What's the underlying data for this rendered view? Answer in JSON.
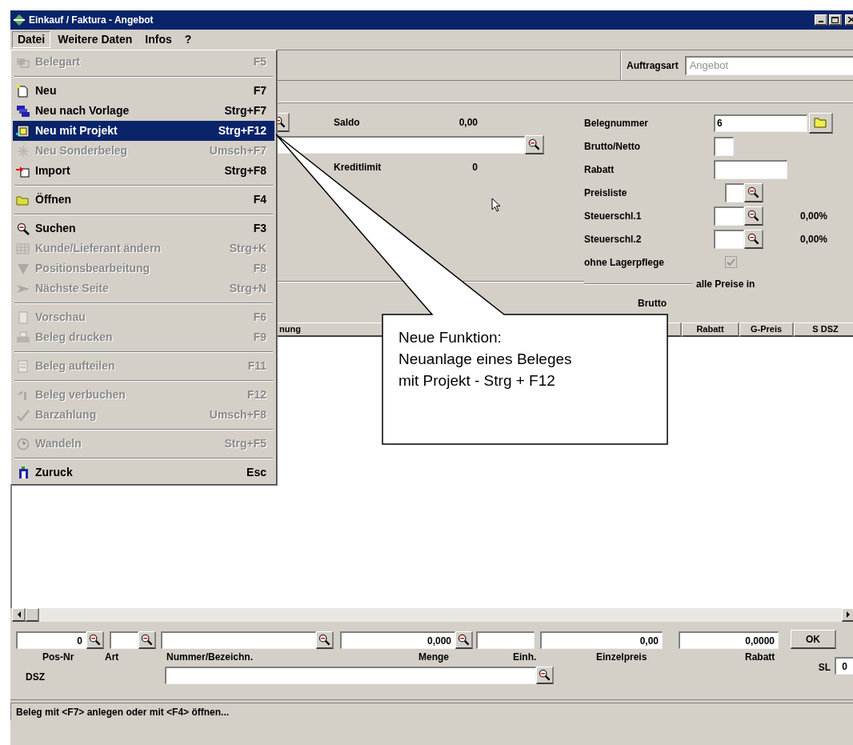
{
  "window": {
    "title": "Einkauf / Faktura - Angebot"
  },
  "menubar": [
    {
      "label": "Datei",
      "selected": true
    },
    {
      "label": "Weitere Daten",
      "selected": false
    },
    {
      "label": "Infos",
      "selected": false
    },
    {
      "label": "?",
      "selected": false
    }
  ],
  "menu": [
    {
      "kind": "item",
      "label": "Belegart",
      "shortcut": "F5",
      "disabled": true,
      "selected": false
    },
    {
      "kind": "separator"
    },
    {
      "kind": "item",
      "label": "Neu",
      "shortcut": "F7",
      "disabled": false,
      "selected": false
    },
    {
      "kind": "item",
      "label": "Neu nach Vorlage",
      "shortcut": "Strg+F7",
      "disabled": false,
      "selected": false
    },
    {
      "kind": "item",
      "label": "Neu mit Projekt",
      "shortcut": "Strg+F12",
      "disabled": false,
      "selected": true
    },
    {
      "kind": "item",
      "label": "Neu Sonderbeleg",
      "shortcut": "Umsch+F7",
      "disabled": true,
      "selected": false
    },
    {
      "kind": "item",
      "label": "Import",
      "shortcut": "Strg+F8",
      "disabled": false,
      "selected": false
    },
    {
      "kind": "separator"
    },
    {
      "kind": "item",
      "label": "Öffnen",
      "shortcut": "F4",
      "disabled": false,
      "selected": false
    },
    {
      "kind": "separator"
    },
    {
      "kind": "item",
      "label": "Suchen",
      "shortcut": "F3",
      "disabled": false,
      "selected": false
    },
    {
      "kind": "item",
      "label": "Kunde/Lieferant ändern",
      "shortcut": "Strg+K",
      "disabled": true,
      "selected": false
    },
    {
      "kind": "item",
      "label": "Positionsbearbeitung",
      "shortcut": "F8",
      "disabled": true,
      "selected": false
    },
    {
      "kind": "item",
      "label": "Nächste Seite",
      "shortcut": "Strg+N",
      "disabled": true,
      "selected": false
    },
    {
      "kind": "separator"
    },
    {
      "kind": "item",
      "label": "Vorschau",
      "shortcut": "F6",
      "disabled": true,
      "selected": false
    },
    {
      "kind": "item",
      "label": "Beleg drucken",
      "shortcut": "F9",
      "disabled": true,
      "selected": false
    },
    {
      "kind": "separator"
    },
    {
      "kind": "item",
      "label": "Beleg aufteilen",
      "shortcut": "F11",
      "disabled": true,
      "selected": false
    },
    {
      "kind": "separator"
    },
    {
      "kind": "item",
      "label": "Beleg verbuchen",
      "shortcut": "F12",
      "disabled": true,
      "selected": false
    },
    {
      "kind": "item",
      "label": "Barzahlung",
      "shortcut": "Umsch+F8",
      "disabled": true,
      "selected": false
    },
    {
      "kind": "separator"
    },
    {
      "kind": "item",
      "label": "Wandeln",
      "shortcut": "Strg+F5",
      "disabled": true,
      "selected": false
    },
    {
      "kind": "separator"
    },
    {
      "kind": "item",
      "label": "Zuruck",
      "shortcut": "Esc",
      "disabled": false,
      "selected": false
    }
  ],
  "auftragsart": {
    "label": "Auftragsart",
    "value": "Angebot"
  },
  "left": {
    "saldo": {
      "label": "Saldo",
      "value": "0,00"
    },
    "kreditlimit": {
      "label": "Kreditlimit",
      "value": "0"
    }
  },
  "right": {
    "belegnummer": {
      "label": "Belegnummer",
      "value": "6"
    },
    "brutto_netto": {
      "label": "Brutto/Netto"
    },
    "rabatt": {
      "label": "Rabatt"
    },
    "preisliste": {
      "label": "Preisliste"
    },
    "steuer": [
      {
        "label": "Steuerschl.1",
        "value": "0,00",
        "unit": "%"
      },
      {
        "label": "Steuerschl.2",
        "value": "0,00",
        "unit": "%"
      }
    ],
    "ohne_lagerpflege": {
      "label": "ohne Lagerpflege",
      "checked": true
    },
    "alle_preise_in": "alle Preise in",
    "preise_modus": "Brutto"
  },
  "grid": {
    "columns": [
      "nung",
      "Rabatt",
      "G-Preis",
      "S DSZ"
    ]
  },
  "entry": {
    "pos_nr": "0",
    "menge": "0,000",
    "einzelpreis": "0,00",
    "rabatt": "0,0000",
    "ok": "OK",
    "labels": [
      "Pos-Nr",
      "Art",
      "Nummer/Bezeichn.",
      "Menge",
      "Einh.",
      "Einzelpreis",
      "Rabatt"
    ],
    "dsz": "DSZ",
    "sl": {
      "label": "SL",
      "value": "0"
    }
  },
  "callout": {
    "text": "Neue Funktion:\nNeuanlage eines Beleges\nmit Projekt - Strg + F12"
  },
  "status_bar": "Beleg mit <F7> anlegen oder mit <F4> öffnen..."
}
